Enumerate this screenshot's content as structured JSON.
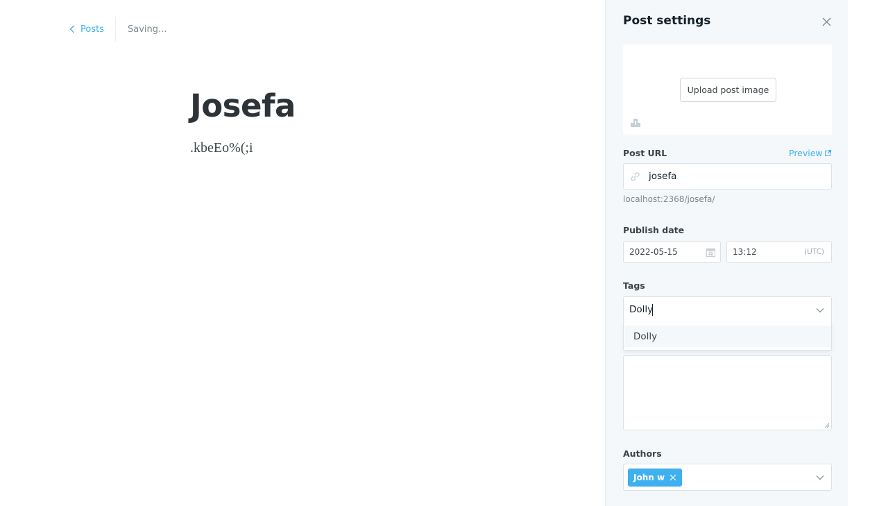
{
  "topbar": {
    "back_label": "Posts",
    "status": "Saving..."
  },
  "editor": {
    "title": "Josefa",
    "body": ".kbeEo%(;i"
  },
  "settings": {
    "title": "Post settings",
    "upload_label": "Upload post image",
    "post_url": {
      "label": "Post URL",
      "preview_label": "Preview",
      "value": "josefa",
      "hint": "localhost:2368/josefa/"
    },
    "publish_date": {
      "label": "Publish date",
      "date": "2022-05-15",
      "time": "13:12",
      "timezone": "(UTC)"
    },
    "tags": {
      "label": "Tags",
      "input_value": "Dolly",
      "suggestions": [
        "Dolly"
      ]
    },
    "authors": {
      "label": "Authors",
      "selected": [
        "John w"
      ]
    }
  },
  "colors": {
    "accent": "#3eb0ef",
    "panel_bg": "#f4f8fb",
    "text_dark": "#15212a"
  },
  "icons": [
    "chevron-left-icon",
    "close-icon",
    "image-icon",
    "link-icon",
    "external-link-icon",
    "calendar-icon",
    "chevron-down-icon",
    "remove-icon"
  ]
}
